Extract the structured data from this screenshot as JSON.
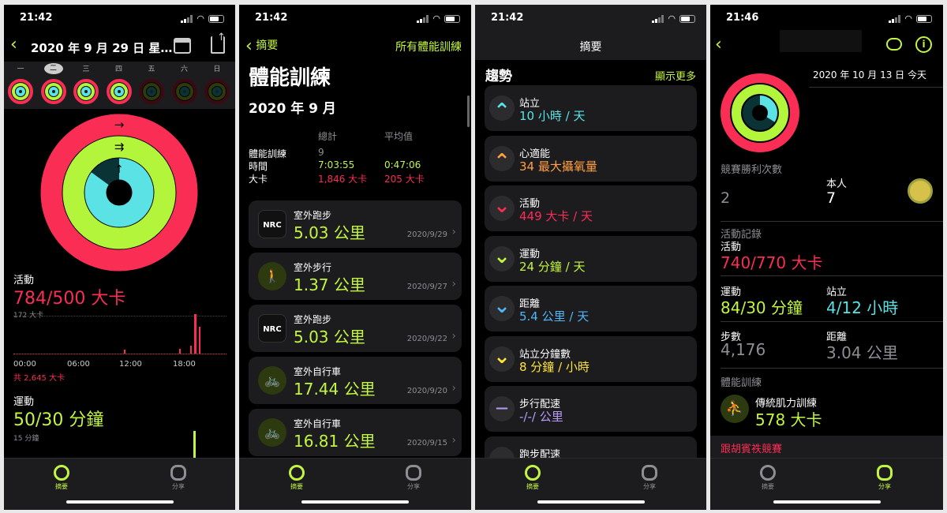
{
  "status": {
    "p1_time": "21:42",
    "p2_time": "21:42",
    "p3_time": "21:42",
    "p4_time": "21:46"
  },
  "tabs": {
    "summary": "摘要",
    "share": "分享"
  },
  "p1": {
    "title": "2020 年 9 月 29 日 星…",
    "weekdays": [
      "一",
      "二",
      "三",
      "四",
      "五",
      "六",
      "日"
    ],
    "activity_label": "活動",
    "activity_value": "784/500 大卡",
    "chart_max": "172 大卡",
    "chart_ticks": [
      "00:00",
      "06:00",
      "12:00",
      "18:00"
    ],
    "chart_total": "共 2,645 大卡",
    "exercise_label": "運動",
    "exercise_value": "50/30 分鐘",
    "exercise_max": "15 分鐘"
  },
  "p2": {
    "back": "摘要",
    "all": "所有體能訓練",
    "title": "體能訓練",
    "month": "2020 年 9 月",
    "col_total": "總計",
    "col_avg": "平均值",
    "rows": [
      {
        "label": "體能訓練",
        "total": "9",
        "avg": ""
      },
      {
        "label": "時間",
        "total": "7:03:55",
        "avg": "0:47:06"
      },
      {
        "label": "大卡",
        "total": "1,846 大卡",
        "avg": "205 大卡"
      }
    ],
    "workouts": [
      {
        "type": "室外跑步",
        "value": "5.03 公里",
        "date": "2020/9/29",
        "icon": "nrc-icon"
      },
      {
        "type": "室外步行",
        "value": "1.37 公里",
        "date": "2020/9/27",
        "icon": "walk-icon"
      },
      {
        "type": "室外跑步",
        "value": "5.03 公里",
        "date": "2020/9/22",
        "icon": "nrc-icon"
      },
      {
        "type": "室外自行車",
        "value": "17.44 公里",
        "date": "2020/9/20",
        "icon": "bike-icon"
      },
      {
        "type": "室外自行車",
        "value": "16.81 公里",
        "date": "2020/9/15",
        "icon": "bike-icon"
      }
    ],
    "nrc": "NRC"
  },
  "p3": {
    "title": "摘要",
    "section": "趨勢",
    "more": "顯示更多",
    "trends": [
      {
        "label": "站立",
        "value": "10 小時 / 天",
        "color": "#5ae2e5",
        "dir": "up"
      },
      {
        "label": "心適能",
        "value": "34 最大攝氧量",
        "color": "#ff9f45",
        "dir": "up"
      },
      {
        "label": "活動",
        "value": "449 大卡 / 天",
        "color": "#fa2d55",
        "dir": "down"
      },
      {
        "label": "運動",
        "value": "24 分鐘 / 天",
        "color": "#c2f542",
        "dir": "down"
      },
      {
        "label": "距離",
        "value": "5.4 公里 / 天",
        "color": "#4fb6f7",
        "dir": "down"
      },
      {
        "label": "站立分鐘數",
        "value": "8 分鐘 / 小時",
        "color": "#ffe43a",
        "dir": "down"
      },
      {
        "label": "步行配速",
        "value": "-/-/ 公里",
        "color": "#b69cf7",
        "dir": "flat"
      },
      {
        "label": "跑步配速",
        "value": "",
        "color": "#b69cf7",
        "dir": "flat"
      }
    ]
  },
  "p4": {
    "date": "2020 年 10 月 13 日 今天",
    "wins_label": "競賽勝利次數",
    "wins_opp": "2",
    "self_label": "本人",
    "self_value": "7",
    "record_label": "活動記錄",
    "activity_label": "活動",
    "activity_value": "740/770 大卡",
    "exercise_label": "運動",
    "exercise_value": "84/30 分鐘",
    "stand_label": "站立",
    "stand_value": "4/12 小時",
    "steps_label": "步數",
    "steps_value": "4,176",
    "distance_label": "距離",
    "distance_value": "3.04 公里",
    "workout_label": "體能訓練",
    "workout_type": "傳統肌力訓練",
    "workout_value": "578 大卡",
    "link": "跟胡賓祑競賽"
  }
}
